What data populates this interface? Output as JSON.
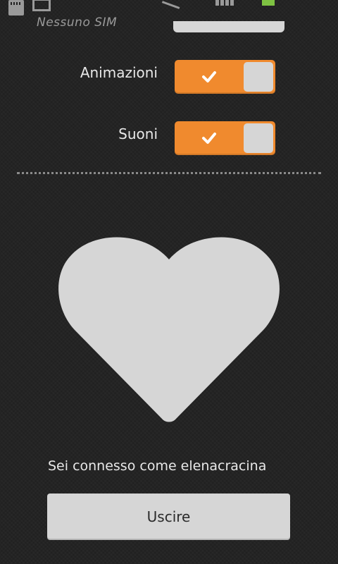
{
  "status_bar": {
    "carrier": "Nessuno SIM",
    "battery_color": "#7ec242"
  },
  "settings": [
    {
      "label": "Animazioni",
      "enabled": true
    },
    {
      "label": "Suoni",
      "enabled": true
    }
  ],
  "colors": {
    "accent": "#f08a2e",
    "knob": "#d6d6d6",
    "background": "#222222"
  },
  "account": {
    "status_text": "Sei connesso come elenacracina",
    "logout_label": "Uscire"
  }
}
